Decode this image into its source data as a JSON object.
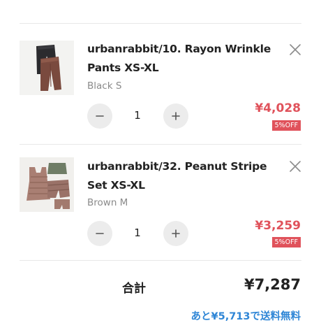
{
  "colors": {
    "price": "#e0525b",
    "badge_bg": "#e0525b",
    "link": "#2f86d6",
    "muted": "#8a8a8a",
    "qty_button_bg": "#ececec"
  },
  "cart": {
    "items": [
      {
        "title": "urbanrabbit/10. Rayon Wrinkle Pants XS-XL",
        "variant": "Black S",
        "quantity": "1",
        "price": "¥4,028",
        "discount": "5%OFF",
        "thumbnail_icon": "pants-photo",
        "remove_icon": "close-icon",
        "decrement_icon": "minus-icon",
        "increment_icon": "plus-icon"
      },
      {
        "title": "urbanrabbit/32. Peanut Stripe Set XS-XL",
        "variant": "Brown M",
        "quantity": "1",
        "price": "¥3,259",
        "discount": "5%OFF",
        "thumbnail_icon": "stripe-set-photo",
        "remove_icon": "close-icon",
        "decrement_icon": "minus-icon",
        "increment_icon": "plus-icon"
      }
    ]
  },
  "summary": {
    "total_label": "合計",
    "total_value": "¥7,287",
    "free_shipping_note": "あと¥5,713で送料無料"
  }
}
